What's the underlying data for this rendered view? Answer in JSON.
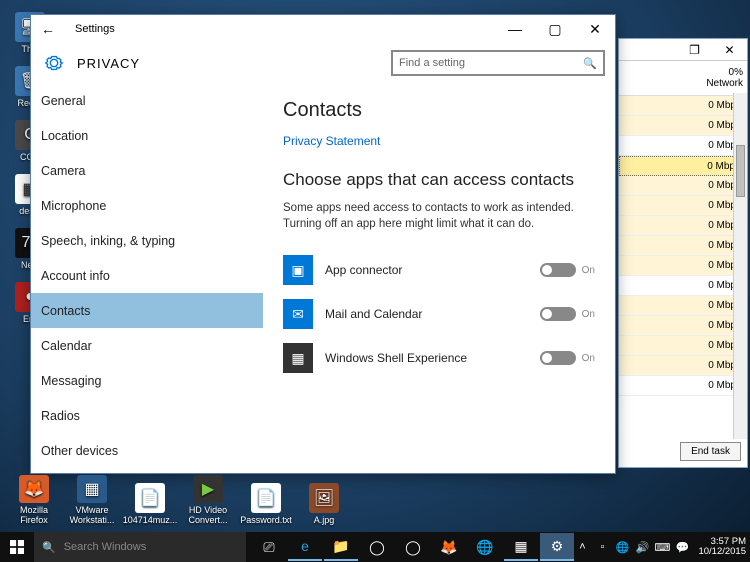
{
  "settings": {
    "title": "Settings",
    "category": "PRIVACY",
    "search_placeholder": "Find a setting",
    "sidebar": [
      "General",
      "Location",
      "Camera",
      "Microphone",
      "Speech, inking, & typing",
      "Account info",
      "Contacts",
      "Calendar",
      "Messaging",
      "Radios",
      "Other devices"
    ],
    "active_index": 6,
    "page": {
      "heading": "Contacts",
      "privacy_link": "Privacy Statement",
      "subheading": "Choose apps that can access contacts",
      "description": "Some apps need access to contacts to work as intended. Turning off an app here might limit what it can do.",
      "apps": [
        {
          "name": "App connector",
          "state": "On",
          "key": "app-connector"
        },
        {
          "name": "Mail and Calendar",
          "state": "On",
          "key": "mail-calendar"
        },
        {
          "name": "Windows Shell Experience",
          "state": "On",
          "key": "shell-experience"
        }
      ]
    }
  },
  "taskmgr": {
    "pct": "0%",
    "col": "Network",
    "rows": [
      "0 Mbps",
      "0 Mbps",
      "0 Mbps",
      "0 Mbps",
      "0 Mbps",
      "0 Mbps",
      "0 Mbps",
      "0 Mbps",
      "0 Mbps",
      "0 Mbps",
      "0 Mbps",
      "0 Mbps",
      "0 Mbps",
      "0 Mbps",
      "0 Mbps"
    ],
    "endtask": "End task"
  },
  "desktop_left": [
    "This",
    "Recyc",
    "CCle",
    "deskt",
    "New",
    "Era"
  ],
  "desktop_bottom": [
    "Mozilla Firefox",
    "VMware Workstati...",
    "104714muz...",
    "HD Video Convert...",
    "Password.txt",
    "A.jpg"
  ],
  "taskbar": {
    "search": "Search Windows",
    "clock_time": "3:57 PM",
    "clock_date": "10/12/2015"
  }
}
